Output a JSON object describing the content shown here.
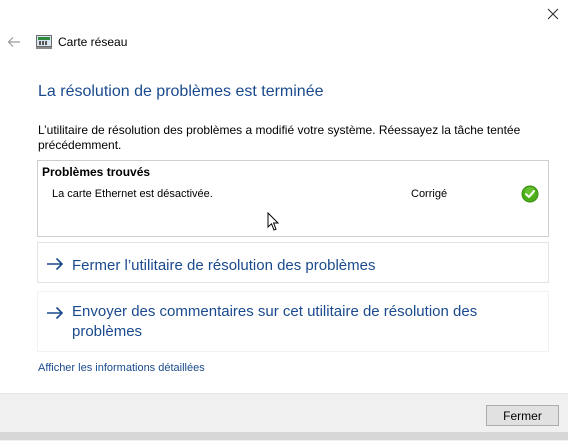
{
  "window": {
    "title": "Carte réseau",
    "close_icon": "close-icon",
    "back_icon": "back-arrow-icon",
    "app_icon": "network-adapter-icon"
  },
  "main": {
    "heading": "La résolution de problèmes est terminée",
    "description": "L’utilitaire de résolution des problèmes a modifié votre système. Réessayez la tâche tentée précédemment."
  },
  "problems": {
    "header": "Problèmes trouvés",
    "items": [
      {
        "name": "La carte Ethernet est désactivée.",
        "status": "Corrigé",
        "status_icon": "check-icon",
        "status_color": "#4caf1a"
      }
    ]
  },
  "actions": {
    "close_troubleshooter": "Fermer l’utilitaire de résolution des problèmes",
    "send_feedback": "Envoyer des commentaires sur cet utilitaire de résolution des problèmes",
    "arrow_icon": "arrow-right-icon"
  },
  "links": {
    "details": "Afficher les informations détaillées"
  },
  "footer": {
    "close_button": "Fermer"
  },
  "colors": {
    "accent": "#1a4a8e",
    "footer_bg": "#f0f0f0"
  }
}
